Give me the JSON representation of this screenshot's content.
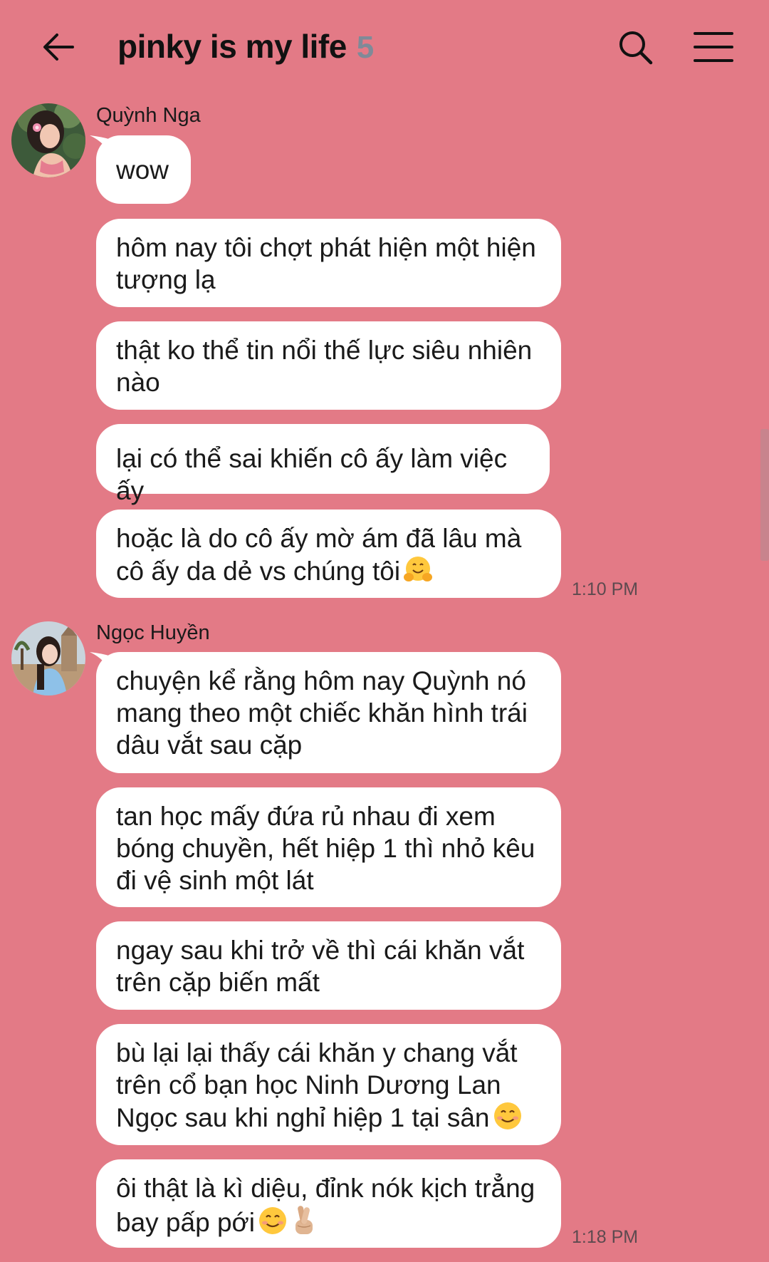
{
  "header": {
    "back_icon": "arrow-left-icon",
    "title": "pinky is my life",
    "member_count": "5",
    "search_icon": "search-icon",
    "menu_icon": "hamburger-menu-icon"
  },
  "colors": {
    "background": "#e37a86",
    "bubble": "#ffffff",
    "member_count": "#7f8a98",
    "timestamp": "#5d4a4f"
  },
  "groups": [
    {
      "sender": "Quỳnh Nga",
      "time": "1:10 PM",
      "messages": [
        "wow",
        "hôm nay tôi chợt phát hiện một hiện tượng lạ",
        "thật ko thể tin nổi thế lực siêu nhiên nào",
        "lại có thể sai khiến cô ấy làm việc ấy",
        "hoặc là do cô ấy mờ ám đã lâu mà cô ấy da dẻ vs chúng tôi"
      ]
    },
    {
      "sender": "Ngọc Huyền",
      "time": "1:18 PM",
      "messages": [
        "chuyện kể rằng hôm nay Quỳnh nó mang theo một chiếc khăn hình trái dâu vắt sau cặp",
        "tan học mấy đứa rủ nhau đi xem bóng chuyền, hết hiệp 1 thì nhỏ kêu đi vệ sinh một lát",
        "ngay sau khi trở về thì cái khăn vắt trên cặp biến mất",
        "bù lại lại thấy cái khăn y chang vắt trên cổ bạn học Ninh Dương Lan Ngọc sau khi nghỉ hiệp 1 tại sân",
        "ôi thật là kì diệu, đỉnk nók kịch trẳng bay pấp pới"
      ]
    }
  ],
  "emoji_icons": {
    "hug": "hugging-face-emoji",
    "smile": "smiling-face-emoji",
    "crossed_fingers": "crossed-fingers-emoji"
  }
}
